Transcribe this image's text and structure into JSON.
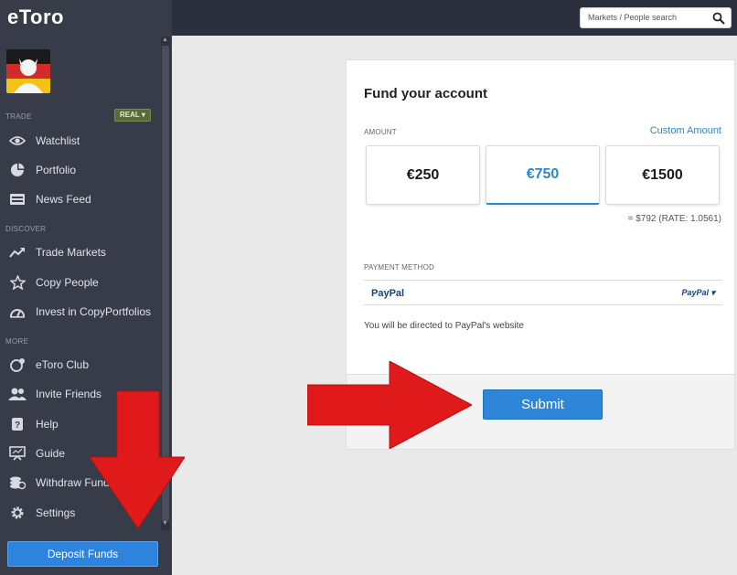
{
  "brand": {
    "logo_text": "eToro"
  },
  "search": {
    "placeholder": "Markets / People search",
    "icon": "search-icon"
  },
  "sidebar": {
    "sections": {
      "trade": "TRADE",
      "discover": "DISCOVER",
      "more": "MORE"
    },
    "account_mode_badge": "REAL",
    "items": [
      {
        "label": "Watchlist",
        "icon": "eye-icon"
      },
      {
        "label": "Portfolio",
        "icon": "pie-chart-icon"
      },
      {
        "label": "News Feed",
        "icon": "newspaper-icon"
      },
      {
        "label": "Trade Markets",
        "icon": "trend-up-icon"
      },
      {
        "label": "Copy People",
        "icon": "star-icon"
      },
      {
        "label": "Invest in CopyPortfolios",
        "icon": "gauge-icon"
      },
      {
        "label": "eToro Club",
        "icon": "club-icon"
      },
      {
        "label": "Invite Friends",
        "icon": "users-icon"
      },
      {
        "label": "Help",
        "icon": "help-icon"
      },
      {
        "label": "Guide",
        "icon": "presentation-icon"
      },
      {
        "label": "Withdraw Funds",
        "icon": "coins-icon"
      },
      {
        "label": "Settings",
        "icon": "gear-icon"
      }
    ],
    "deposit_label": "Deposit Funds"
  },
  "fund": {
    "title": "Fund your account",
    "amount_label": "AMOUNT",
    "custom_amount": "Custom Amount",
    "amounts": [
      "€250",
      "€750",
      "€1500"
    ],
    "selected_amount": "€750",
    "rate_text": "= $792  (RATE: 1.0561)",
    "payment_label": "PAYMENT METHOD",
    "payment_method": "PayPal",
    "payment_selector": "PayPal",
    "redirect_note": "You will be directed to PayPal's website",
    "submit_label": "Submit"
  },
  "colors": {
    "sidebar": "#383b48",
    "accent_blue": "#2f86d9",
    "annotation_arrow": "#e0191b"
  }
}
